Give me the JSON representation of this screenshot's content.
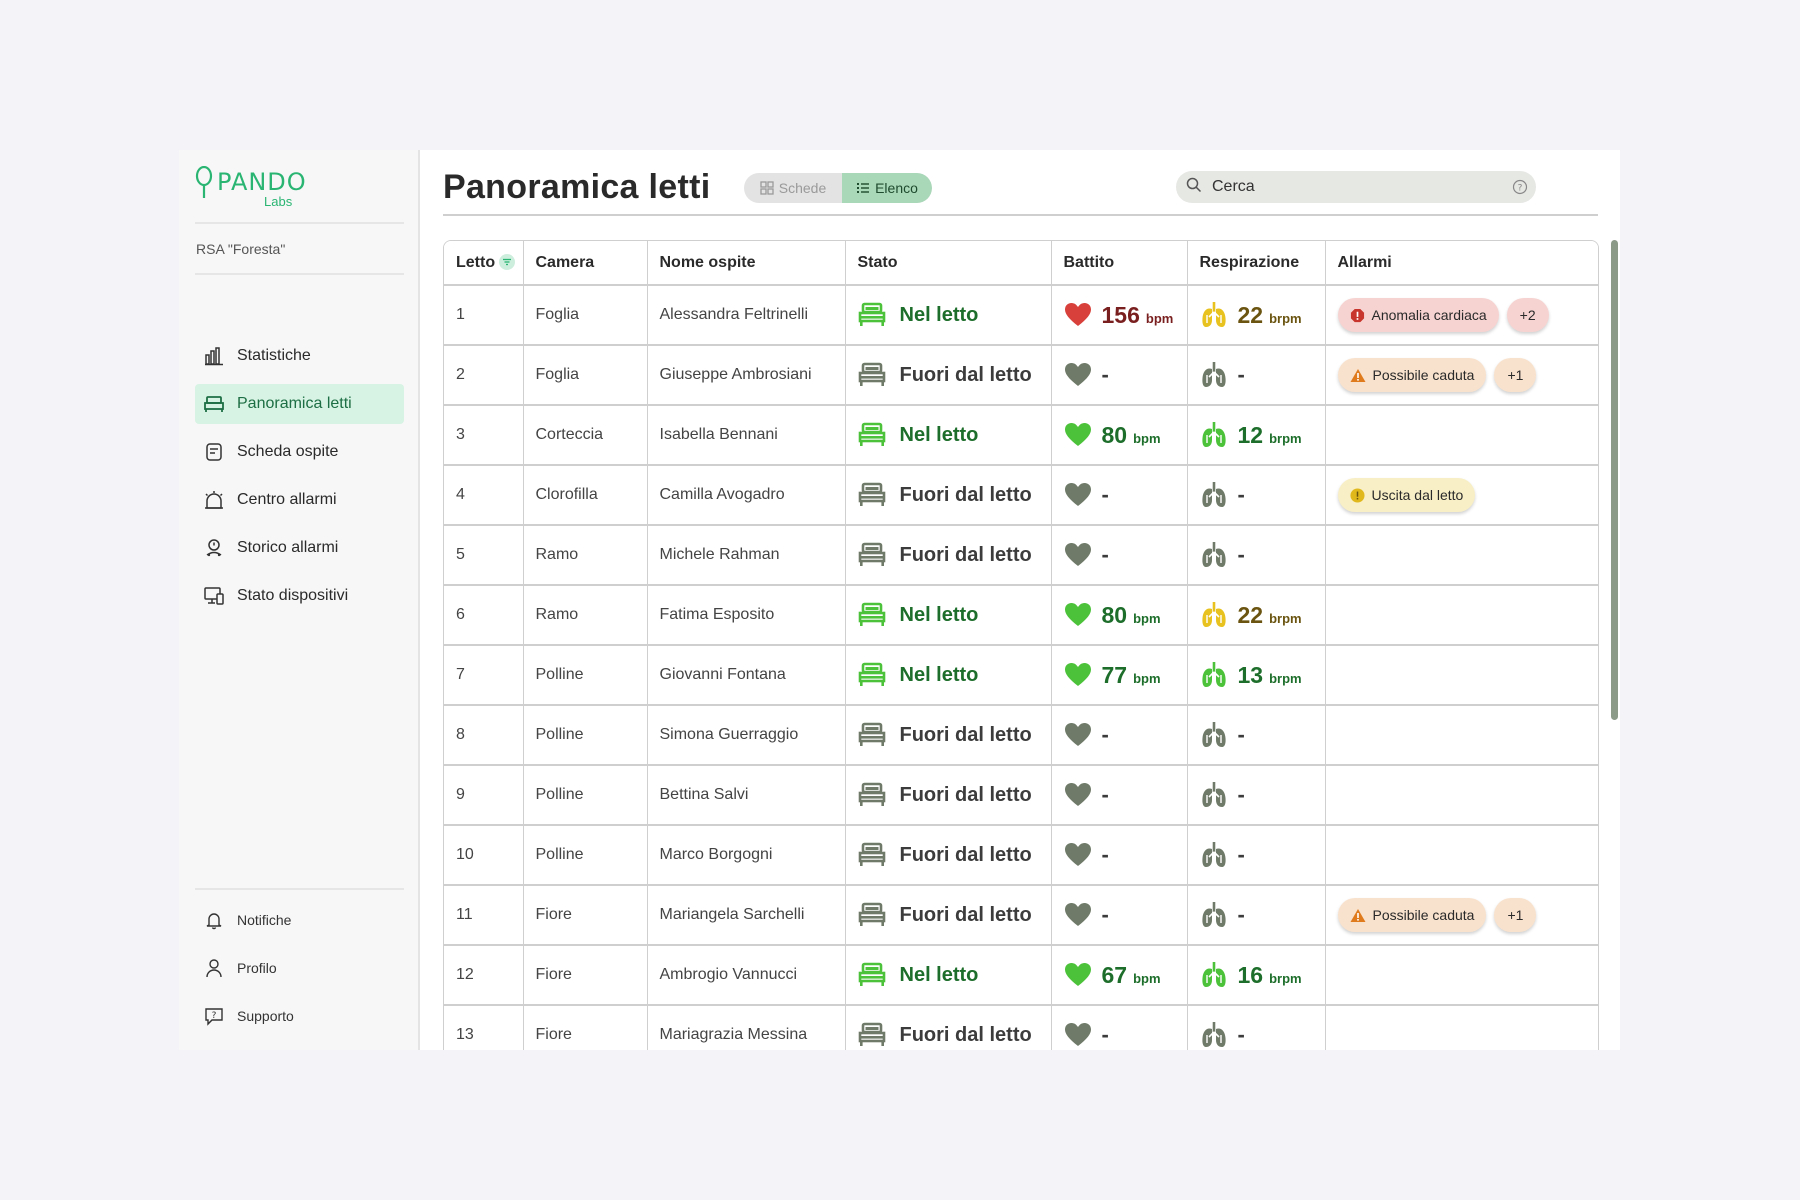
{
  "brand": {
    "logo_word": "PANDO",
    "logo_sub": "Labs",
    "accent": "#2bb573"
  },
  "facility": "RSA \"Foresta\"",
  "sidebar": {
    "items": [
      {
        "label": "Statistiche",
        "icon": "bar-chart-icon",
        "active": false
      },
      {
        "label": "Panoramica letti",
        "icon": "bed-icon",
        "active": true
      },
      {
        "label": "Scheda ospite",
        "icon": "guest-card-icon",
        "active": false
      },
      {
        "label": "Centro allarmi",
        "icon": "alarm-bell-icon",
        "active": false
      },
      {
        "label": "Storico allarmi",
        "icon": "alarm-history-icon",
        "active": false
      },
      {
        "label": "Stato dispositivi",
        "icon": "devices-icon",
        "active": false
      }
    ],
    "bottom": [
      {
        "label": "Notifiche",
        "icon": "bell-icon"
      },
      {
        "label": "Profilo",
        "icon": "user-icon"
      },
      {
        "label": "Supporto",
        "icon": "support-chat-icon"
      }
    ]
  },
  "header": {
    "title": "Panoramica letti",
    "toggle": {
      "cards_label": "Schede",
      "list_label": "Elenco",
      "selected": "Elenco"
    },
    "search_placeholder": "Cerca"
  },
  "table": {
    "columns": [
      "Letto",
      "Camera",
      "Nome ospite",
      "Stato",
      "Battito",
      "Respirazione",
      "Allarmi"
    ],
    "bpm_unit": "bpm",
    "brpm_unit": "brpm",
    "status_in": "Nel letto",
    "status_out": "Fuori dal letto",
    "rows": [
      {
        "bed": "1",
        "room": "Foglia",
        "name": "Alessandra Feltrinelli",
        "in_bed": true,
        "bpm": "156",
        "bpm_level": "red",
        "brpm": "22",
        "brpm_level": "yellow",
        "alarms": [
          {
            "text": "Anomalia cardiaca",
            "level": "red"
          }
        ],
        "extra": "+2",
        "extra_level": "red"
      },
      {
        "bed": "2",
        "room": "Foglia",
        "name": "Giuseppe Ambrosiani",
        "in_bed": false,
        "bpm": "-",
        "brpm": "-",
        "alarms": [
          {
            "text": "Possibile caduta",
            "level": "orange"
          }
        ],
        "extra": "+1",
        "extra_level": "orange"
      },
      {
        "bed": "3",
        "room": "Corteccia",
        "name": "Isabella Bennani",
        "in_bed": true,
        "bpm": "80",
        "bpm_level": "green",
        "brpm": "12",
        "brpm_level": "green",
        "alarms": []
      },
      {
        "bed": "4",
        "room": "Clorofilla",
        "name": "Camilla Avogadro",
        "in_bed": false,
        "bpm": "-",
        "brpm": "-",
        "alarms": [
          {
            "text": "Uscita dal letto",
            "level": "yellow"
          }
        ]
      },
      {
        "bed": "5",
        "room": "Ramo",
        "name": "Michele Rahman",
        "in_bed": false,
        "bpm": "-",
        "brpm": "-",
        "alarms": []
      },
      {
        "bed": "6",
        "room": "Ramo",
        "name": "Fatima Esposito",
        "in_bed": true,
        "bpm": "80",
        "bpm_level": "green",
        "brpm": "22",
        "brpm_level": "yellow",
        "alarms": []
      },
      {
        "bed": "7",
        "room": "Polline",
        "name": "Giovanni Fontana",
        "in_bed": true,
        "bpm": "77",
        "bpm_level": "green",
        "brpm": "13",
        "brpm_level": "green",
        "alarms": []
      },
      {
        "bed": "8",
        "room": "Polline",
        "name": "Simona Guerraggio",
        "in_bed": false,
        "bpm": "-",
        "brpm": "-",
        "alarms": []
      },
      {
        "bed": "9",
        "room": "Polline",
        "name": "Bettina Salvi",
        "in_bed": false,
        "bpm": "-",
        "brpm": "-",
        "alarms": []
      },
      {
        "bed": "10",
        "room": "Polline",
        "name": "Marco Borgogni",
        "in_bed": false,
        "bpm": "-",
        "brpm": "-",
        "alarms": []
      },
      {
        "bed": "11",
        "room": "Fiore",
        "name": "Mariangela Sarchelli",
        "in_bed": false,
        "bpm": "-",
        "brpm": "-",
        "alarms": [
          {
            "text": "Possibile caduta",
            "level": "orange"
          }
        ],
        "extra": "+1",
        "extra_level": "orange"
      },
      {
        "bed": "12",
        "room": "Fiore",
        "name": "Ambrogio Vannucci",
        "in_bed": true,
        "bpm": "67",
        "bpm_level": "green",
        "brpm": "16",
        "brpm_level": "green",
        "alarms": []
      },
      {
        "bed": "13",
        "room": "Fiore",
        "name": "Mariagrazia Messina",
        "in_bed": false,
        "bpm": "-",
        "brpm": "-",
        "alarms": []
      }
    ]
  },
  "colors": {
    "in_bed": "#4cc23a",
    "out_bed": "#6f7a68",
    "heart_red": "#d8413b",
    "heart_green": "#4cc23a",
    "lung_yellow": "#e8c21e",
    "lung_green": "#4cc23a",
    "grey_icon": "#6f7a68",
    "alarm_red": "#c8352c",
    "alarm_orange": "#e07b1d",
    "alarm_yellow": "#e0b81c"
  }
}
